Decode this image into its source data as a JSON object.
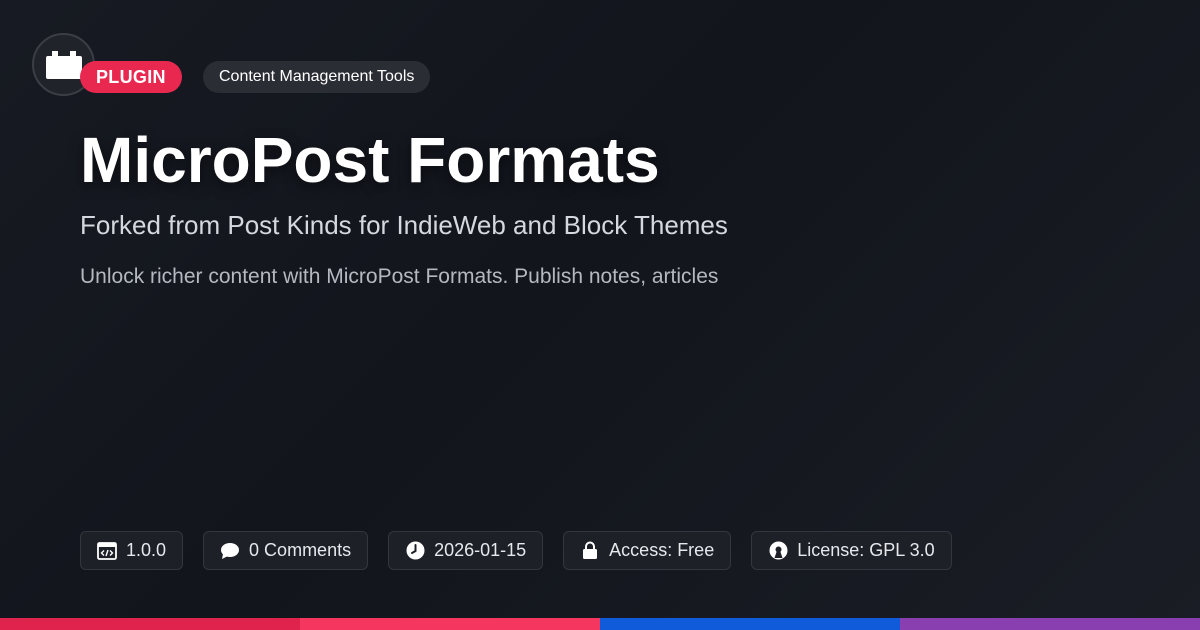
{
  "badges": {
    "type": "PLUGIN",
    "category": "Content Management Tools"
  },
  "title": "MicroPost Formats",
  "subtitle": "Forked from Post Kinds for IndieWeb and Block Themes",
  "description": "Unlock richer content with MicroPost Formats. Publish notes, articles",
  "meta": {
    "version": "1.0.0",
    "comments": "0 Comments",
    "date": "2026-01-15",
    "access": "Access: Free",
    "license": "License: GPL 3.0"
  },
  "icons": {
    "logo": "plugin-block-icon",
    "version": "code-window-icon",
    "comments": "speech-bubble-icon",
    "date": "clock-icon",
    "access": "lock-icon",
    "license": "open-source-icon"
  },
  "colors": {
    "plugin_badge": "#e8284f",
    "bottom_bar": [
      "#e0234d",
      "#f5365f",
      "#0f5bd9",
      "#8a3fb0"
    ]
  }
}
